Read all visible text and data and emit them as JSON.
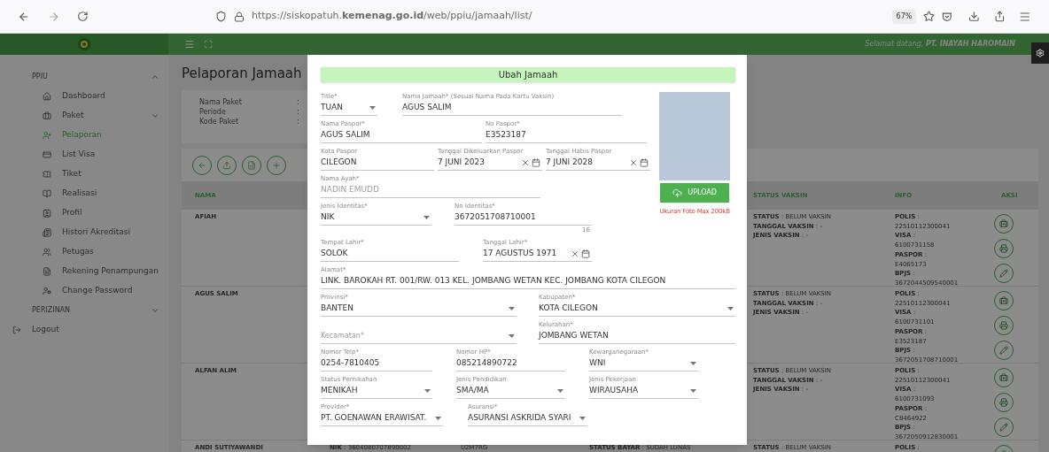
{
  "browser": {
    "url": "https://siskopatuh.**kemenag.go.id**/web/ppiu/jamaah/list/",
    "zoom": "67%"
  },
  "header": {
    "welcome": "Selamat datang, **PT. INAYAH HAROMAIN**"
  },
  "sidebar": {
    "sections": [
      {
        "title": "PPIU",
        "expanded": true,
        "items": [
          {
            "label": "Dashboard",
            "kind": "link",
            "selected": false
          },
          {
            "label": "Paket",
            "kind": "group",
            "expanded": false,
            "selected": false
          },
          {
            "label": "Pelaporan",
            "kind": "link",
            "selected": true
          },
          {
            "label": "List Visa",
            "kind": "link",
            "selected": false
          },
          {
            "label": "Tiket",
            "kind": "link",
            "selected": false
          },
          {
            "label": "Realisasi",
            "kind": "link",
            "selected": false
          },
          {
            "label": "Profil",
            "kind": "link",
            "selected": false
          },
          {
            "label": "Histori Akreditasi",
            "kind": "link",
            "selected": false
          },
          {
            "label": "Petugas",
            "kind": "link",
            "selected": false
          },
          {
            "label": "Rekening Penampungan",
            "kind": "link",
            "selected": false
          },
          {
            "label": "Change Password",
            "kind": "link",
            "selected": false
          }
        ]
      },
      {
        "title": "PERIZINAN",
        "expanded": false
      }
    ],
    "logout": "Logout"
  },
  "page": {
    "title": "Pelaporan Jamaah",
    "info": [
      {
        "label": "Nama Paket",
        "sep": ":"
      },
      {
        "label": "Periode",
        "sep": ":"
      },
      {
        "label": "Kode Paket",
        "sep": ":"
      }
    ]
  },
  "table": {
    "columns": [
      "NAMA",
      "STATUS VAKSIN",
      "INFO",
      "AKSI"
    ],
    "rows": [
      {
        "name": "AFIAH",
        "vaksin": [
          "**STATUS** : BELUM VAKSIN",
          "**TANGGAL VAKSIN** : -",
          "**JENIS VAKSIN** : -"
        ],
        "info": [
          "**POLIS** :",
          "22510112300041",
          "**VISA** :",
          "6100731158",
          "**PASPOR** :",
          "E4065173",
          "**BPJS** :",
          "3672044509540001"
        ]
      },
      {
        "name": "AGUS SALIM",
        "vaksin": [
          "**STATUS** : BELUM VAKSIN",
          "**TANGGAL VAKSIN** : -",
          "**JENIS VAKSIN** : -"
        ],
        "info": [
          "**POLIS** :",
          "22510112300041",
          "**VISA** :",
          "6100731101",
          "**PASPOR** :",
          "E3523187",
          "**BPJS** :",
          "3672051708710001"
        ]
      },
      {
        "name": "ALFAN ALIM",
        "vaksin": [
          "**STATUS** : BELUM VAKSIN",
          "**TANGGAL VAKSIN** : -",
          "**JENIS VAKSIN** : -"
        ],
        "info": [
          "**POLIS** :",
          "22510112300041",
          "**VISA** :",
          "6100731093",
          "**PASPOR** :",
          "C8464922",
          "**BPJS** :",
          "3672050912830001"
        ]
      },
      {
        "name": "ANDI SUTIYAWANDI",
        "details": [
          "**NIK** : 3604080707890002",
          "U2M7RG",
          "**STATUS BAYAR** : SUDAH LUNAS"
        ],
        "vaksin": [
          "**STATUS** : BELUM VAKSIN"
        ],
        "info": [
          "**POLIS** :"
        ]
      }
    ]
  },
  "modal": {
    "title": "Ubah Jamaah",
    "top_rows": [
      [
        {
          "label": "Title*",
          "value": "TUAN",
          "kind": "select"
        },
        {
          "label": "Nama Jamaah* (Sesuai Nama Pada Kartu Vaksin)",
          "value": "AGUS SALIM",
          "kind": "text"
        }
      ],
      [
        {
          "label": "Nama Paspor*",
          "value": "AGUS SALIM",
          "kind": "text"
        },
        {
          "label": "No Paspor*",
          "value": "E3523187",
          "kind": "text"
        }
      ],
      [
        {
          "label": "Kota Paspor",
          "value": "CILEGON",
          "kind": "text"
        },
        {
          "label": "Tanggal Dikeluarkan Paspor",
          "value": "7 JUNI 2023",
          "kind": "date"
        },
        {
          "label": "Tanggal Habis Paspor",
          "value": "7 JUNI 2028",
          "kind": "date"
        }
      ],
      [
        {
          "label": "Nama Ayah*",
          "value": "NADIN EMUDD",
          "kind": "readonly"
        }
      ],
      [
        {
          "label": "Jenis Identitas*",
          "value": "NIK",
          "kind": "select"
        },
        {
          "label": "No Identitas*",
          "value": "3672051708710001",
          "kind": "text",
          "counter": "16"
        }
      ]
    ],
    "rows": [
      [
        {
          "label": "Tempat Lahir*",
          "value": "SOLOK",
          "kind": "text"
        },
        {
          "label": "Tanggal Lahir*",
          "value": "17 AGUSTUS 1971",
          "kind": "date"
        }
      ],
      [
        {
          "label": "Alamat*",
          "value": "LINK. BAROKAH RT. 001/RW. 013 KEL. JOMBANG WETAN KEC. JOMBANG KOTA CILEGON",
          "kind": "text"
        }
      ],
      [
        {
          "label": "Provinsi*",
          "value": "BANTEN",
          "kind": "select"
        },
        {
          "label": "Kabupaten*",
          "value": "KOTA CILEGON",
          "kind": "select"
        }
      ],
      [
        {
          "label": "Kecamatan*",
          "kind": "select"
        },
        {
          "label": "Kelurahan*",
          "value": "JOMBANG WETAN",
          "kind": "text"
        }
      ],
      [
        {
          "label": "Nomor Telp*",
          "value": "0254-7810405",
          "kind": "text"
        },
        {
          "label": "Nomor HP*",
          "value": "085214890722",
          "kind": "text"
        },
        {
          "label": "Kewarganegaraan*",
          "value": "WNI",
          "kind": "select"
        }
      ],
      [
        {
          "label": "Status Pernikahan",
          "value": "MENIKAH",
          "kind": "select"
        },
        {
          "label": "Jenis Pendidikan",
          "value": "SMA/MA",
          "kind": "select"
        },
        {
          "label": "Jenis Pekerjaan",
          "value": "WIRAUSAHA",
          "kind": "select"
        }
      ],
      [
        {
          "label": "Provider*",
          "value": "PT. GOENAWAN ERAWISAT.",
          "kind": "select"
        },
        {
          "label": "Asuransi*",
          "value": "ASURANSI ASKRIDA SYARI",
          "kind": "select"
        }
      ]
    ],
    "photo": {
      "button": "UPLOAD",
      "note": "Ukuran Foto Max 200kB"
    }
  }
}
